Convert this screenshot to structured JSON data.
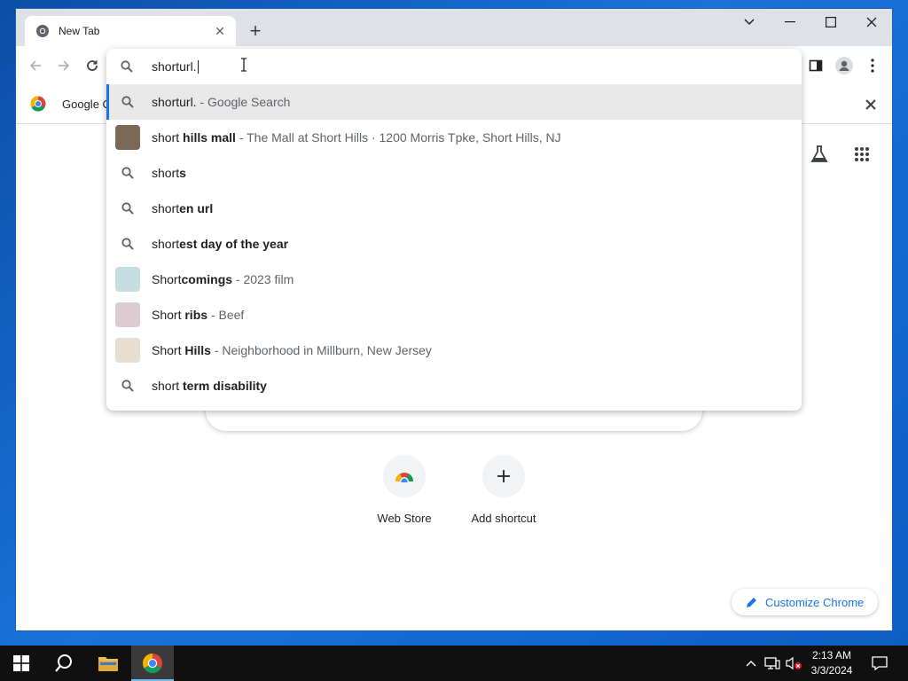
{
  "tab": {
    "title": "New Tab"
  },
  "omnibox": {
    "input_value": "shorturl.",
    "suggestions": [
      {
        "type": "search",
        "prefix": "shorturl.",
        "bold": "",
        "desc": " - Google Search",
        "selected": true
      },
      {
        "type": "entity",
        "prefix": "short ",
        "bold": "hills mall",
        "desc": " - The Mall at Short Hills · 1200 Morris Tpke, Short Hills, NJ",
        "thumb_color": "#7a6a55"
      },
      {
        "type": "search",
        "prefix": "short",
        "bold": "s",
        "desc": ""
      },
      {
        "type": "search",
        "prefix": "short",
        "bold": "en url",
        "desc": ""
      },
      {
        "type": "search",
        "prefix": "short",
        "bold": "est day of the year",
        "desc": ""
      },
      {
        "type": "entity",
        "prefix": "Short",
        "bold": "comings",
        "desc": " - 2023 film",
        "thumb_color": "#c4dde3"
      },
      {
        "type": "entity",
        "prefix": "Short ",
        "bold": "ribs",
        "desc": " - Beef",
        "thumb_color": "#dcccd2"
      },
      {
        "type": "entity",
        "prefix": "Short ",
        "bold": "Hills",
        "desc": " - Neighborhood in Millburn, New Jersey",
        "thumb_color": "#e7ddd0"
      },
      {
        "type": "search",
        "prefix": "short ",
        "bold": "term disability",
        "desc": ""
      }
    ]
  },
  "bookmarks": {
    "item_label": "Google C"
  },
  "shortcuts": [
    {
      "label": "Web Store"
    },
    {
      "label": "Add shortcut"
    }
  ],
  "customize": {
    "label": "Customize Chrome"
  },
  "taskbar": {
    "time": "2:13 AM",
    "date": "3/3/2024"
  },
  "colors": {
    "accent": "#1a73e8",
    "selected_row": "#e8e8e9",
    "taskbar": "#101010"
  },
  "icons": [
    "search-icon",
    "back-icon",
    "forward-icon",
    "reload-icon",
    "sidepanel-icon",
    "profile-icon",
    "menu-icon",
    "labs-icon",
    "apps-icon",
    "pencil-icon"
  ]
}
